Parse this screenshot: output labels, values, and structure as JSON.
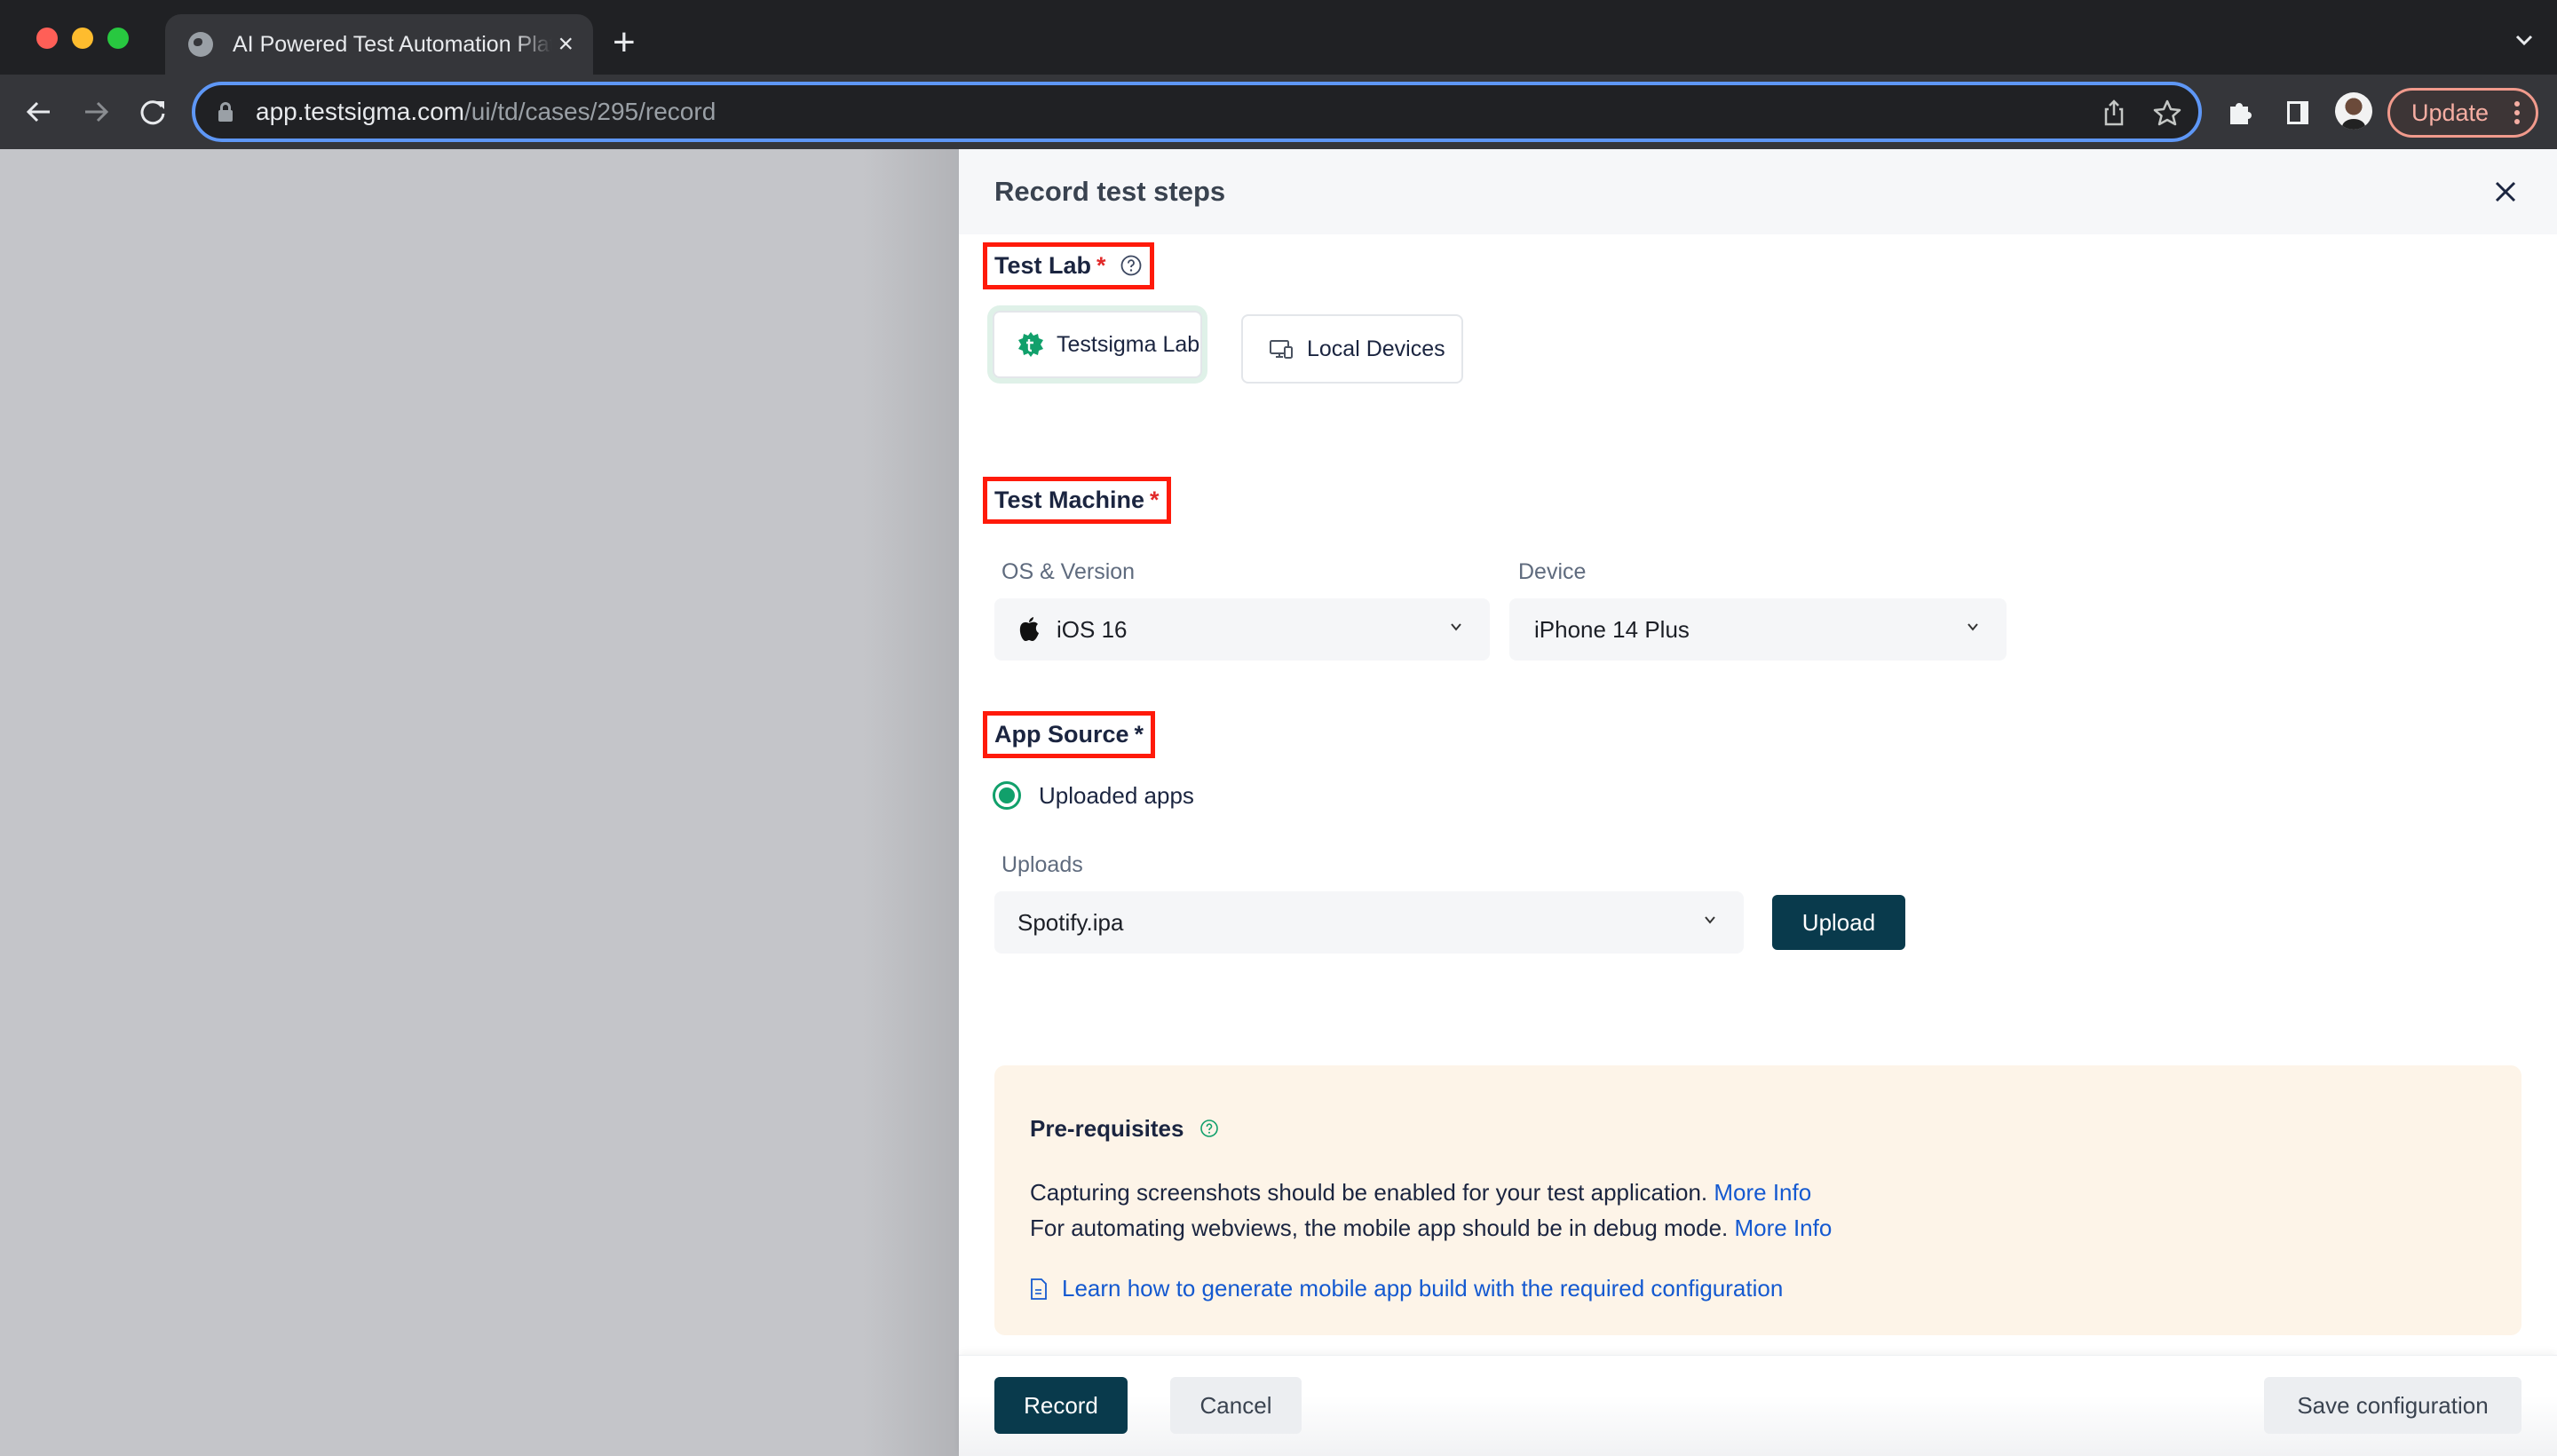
{
  "browser": {
    "tab_title": "AI Powered Test Automation Platform",
    "tab_close": "×",
    "new_tab": "+",
    "url_host": "app.testsigma.com",
    "url_path": "/ui/td/cases/295/record",
    "update_label": "Update"
  },
  "drawer": {
    "title": "Record test steps",
    "test_lab": {
      "label": "Test Lab",
      "required_mark": "*",
      "options": [
        {
          "label": "Testsigma Lab",
          "selected": true
        },
        {
          "label": "Local Devices",
          "selected": false
        }
      ]
    },
    "test_machine": {
      "label": "Test Machine",
      "required_mark": "*",
      "os_label": "OS & Version",
      "os_value": "iOS 16",
      "device_label": "Device",
      "device_value": "iPhone 14 Plus"
    },
    "app_source": {
      "label": "App Source",
      "required_mark": "*",
      "radio_label": "Uploaded apps",
      "radio_selected": true,
      "uploads_label": "Uploads",
      "uploads_value": "Spotify.ipa",
      "upload_button": "Upload"
    },
    "prerequisites": {
      "title": "Pre-requisites",
      "line1_text": "Capturing screenshots should be enabled for your test application.",
      "line1_link": "More Info",
      "line2_text": "For automating webviews, the mobile app should be in debug mode.",
      "line2_link": "More Info",
      "learn_link": "Learn how to generate mobile app build with the required configuration"
    },
    "footer": {
      "record_button": "Record",
      "cancel_button": "Cancel",
      "save_button": "Save configuration"
    }
  },
  "colors": {
    "accent_green": "#11a06b",
    "primary_button": "#093a4c",
    "link_blue": "#1459d0",
    "annotation_red": "#ff1a0a",
    "prereq_bg": "#fdf4e8"
  }
}
